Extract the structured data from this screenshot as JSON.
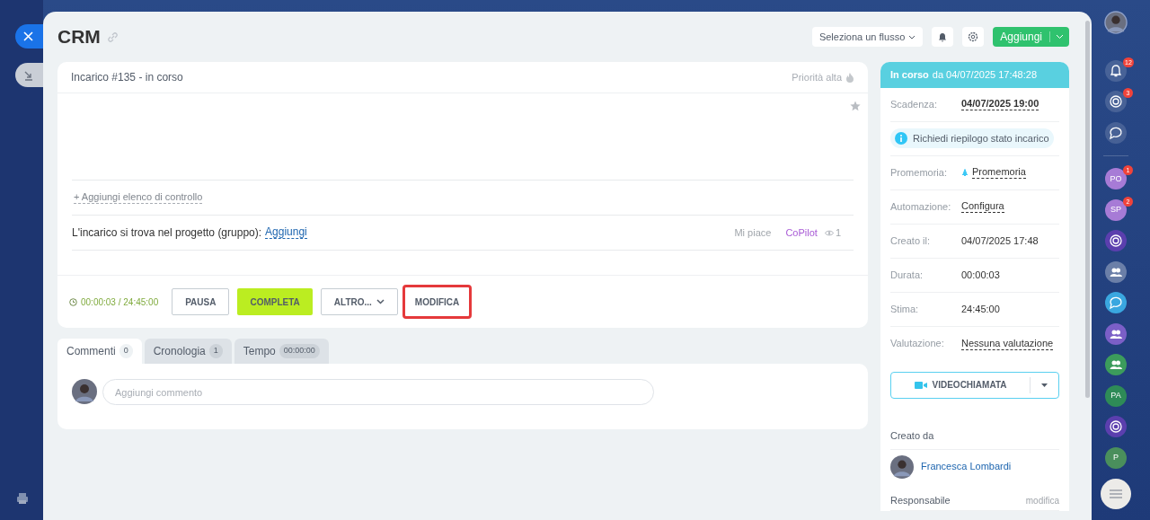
{
  "header": {
    "title": "CRM",
    "flow_select": "Seleziona un flusso",
    "add_button": "Aggiungi"
  },
  "task": {
    "title": "Incarico #135 - in corso",
    "priority": "Priorità alta",
    "checklist_link": "+ Aggiungi elenco di controllo",
    "project_label": "L'incarico si trova nel progetto (gruppo):",
    "project_link": "Aggiungi",
    "like": "Mi piace",
    "copilot": "CoPilot",
    "views": "1",
    "timer": "00:00:03 / 24:45:00",
    "buttons": [
      {
        "label": "PAUSA",
        "kind": "outline",
        "highlighted": false
      },
      {
        "label": "COMPLETA",
        "kind": "primary",
        "highlighted": false
      },
      {
        "label": "ALTRO...",
        "kind": "dropdown",
        "highlighted": false
      },
      {
        "label": "MODIFICA",
        "kind": "plain",
        "highlighted": true
      }
    ]
  },
  "tabs": [
    {
      "label": "Commenti",
      "count": "0",
      "selected": true
    },
    {
      "label": "Cronologia",
      "count": "1",
      "selected": false
    },
    {
      "label": "Tempo",
      "count": "00:00:00",
      "selected": false
    }
  ],
  "comment": {
    "placeholder": "Aggiungi commento"
  },
  "side": {
    "status": "In corso",
    "since": "da 04/07/2025 17:48:28",
    "rows": [
      {
        "kind": "deadline",
        "label": "Scadenza:",
        "value": "04/07/2025 19:00"
      },
      {
        "kind": "info",
        "value": "Richiedi riepilogo stato incarico"
      },
      {
        "kind": "reminder",
        "label": "Promemoria:",
        "value": "Promemoria"
      },
      {
        "kind": "link",
        "label": "Automazione:",
        "value": "Configura"
      },
      {
        "kind": "text",
        "label": "Creato il:",
        "value": "04/07/2025 17:48"
      },
      {
        "kind": "text",
        "label": "Durata:",
        "value": "00:00:03"
      },
      {
        "kind": "text",
        "label": "Stima:",
        "value": "24:45:00"
      },
      {
        "kind": "link",
        "label": "Valutazione:",
        "value": "Nessuna valutazione"
      }
    ],
    "video_button": "VIDEOCHIAMATA",
    "created_by_label": "Creato da",
    "creator": "Francesca Lombardi",
    "responsible_label": "Responsabile",
    "responsible_edit": "modifica"
  },
  "rail": [
    {
      "kind": "avatar"
    },
    {
      "kind": "bell",
      "badge": "12"
    },
    {
      "kind": "target",
      "badge": "3"
    },
    {
      "kind": "chat"
    },
    {
      "kind": "divider"
    },
    {
      "kind": "initials",
      "text": "PO",
      "badge": "1",
      "color": "#a77bd6"
    },
    {
      "kind": "initials",
      "text": "SP",
      "badge": "2",
      "color": "#a77bd6"
    },
    {
      "kind": "target",
      "color": "#5b3fae"
    },
    {
      "kind": "people",
      "color": "#6b7fa8"
    },
    {
      "kind": "chat",
      "color": "#3aa7e0"
    },
    {
      "kind": "people",
      "color": "#7b5fc7"
    },
    {
      "kind": "people",
      "color": "#3c9c5c"
    },
    {
      "kind": "initials",
      "text": "PA",
      "color": "#2e8b57"
    },
    {
      "kind": "target",
      "color": "#5b3fae"
    },
    {
      "kind": "initials",
      "text": "P",
      "color": "#4a8f5c"
    }
  ]
}
